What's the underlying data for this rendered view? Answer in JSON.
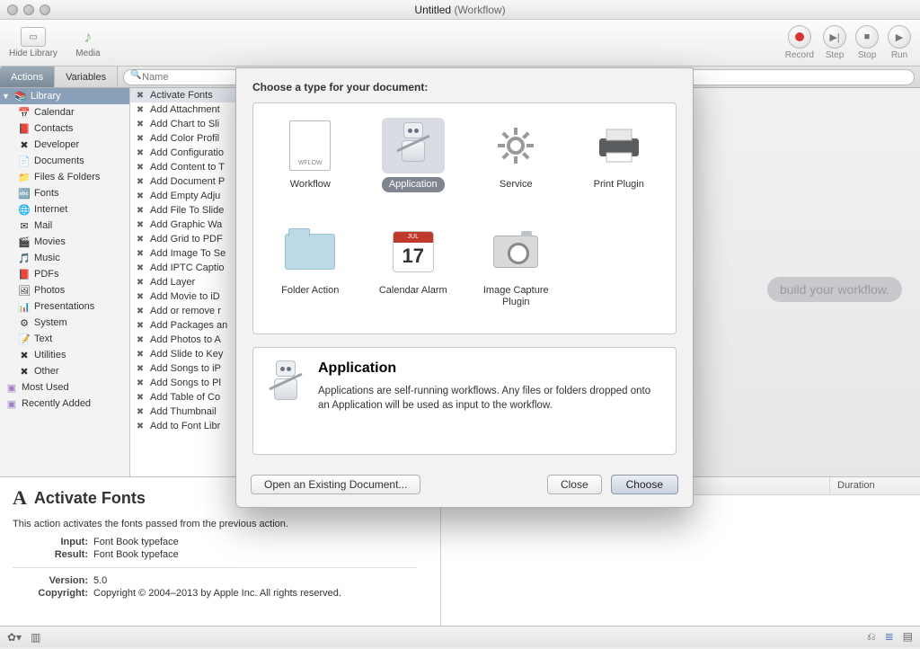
{
  "window": {
    "title_doc": "Untitled",
    "title_app": "(Workflow)"
  },
  "toolbar": {
    "hide_library": "Hide Library",
    "media": "Media",
    "record": "Record",
    "step": "Step",
    "stop": "Stop",
    "run": "Run"
  },
  "tabs": {
    "actions": "Actions",
    "variables": "Variables"
  },
  "search": {
    "placeholder": "Name"
  },
  "sidebar": {
    "library": "Library",
    "items": [
      {
        "icon": "📅",
        "label": "Calendar"
      },
      {
        "icon": "📕",
        "label": "Contacts"
      },
      {
        "icon": "✖",
        "label": "Developer"
      },
      {
        "icon": "📄",
        "label": "Documents"
      },
      {
        "icon": "📁",
        "label": "Files & Folders"
      },
      {
        "icon": "🔤",
        "label": "Fonts"
      },
      {
        "icon": "🌐",
        "label": "Internet"
      },
      {
        "icon": "✉",
        "label": "Mail"
      },
      {
        "icon": "🎬",
        "label": "Movies"
      },
      {
        "icon": "🎵",
        "label": "Music"
      },
      {
        "icon": "📕",
        "label": "PDFs"
      },
      {
        "icon": "🖼",
        "label": "Photos"
      },
      {
        "icon": "📊",
        "label": "Presentations"
      },
      {
        "icon": "⚙",
        "label": "System"
      },
      {
        "icon": "📝",
        "label": "Text"
      },
      {
        "icon": "✖",
        "label": "Utilities"
      },
      {
        "icon": "✖",
        "label": "Other"
      }
    ],
    "most_used": "Most Used",
    "recently_added": "Recently Added"
  },
  "actions": [
    "Activate Fonts",
    "Add Attachment",
    "Add Chart to Sli",
    "Add Color Profil",
    "Add Configuratio",
    "Add Content to T",
    "Add Document P",
    "Add Empty Adju",
    "Add File To Slide",
    "Add Graphic Wa",
    "Add Grid to PDF",
    "Add Image To Se",
    "Add IPTC Captio",
    "Add Layer",
    "Add Movie to iD",
    "Add or remove r",
    "Add Packages an",
    "Add Photos to A",
    "Add Slide to Key",
    "Add Songs to iP",
    "Add Songs to Pl",
    "Add Table of Co",
    "Add Thumbnail",
    "Add to Font Libr"
  ],
  "actions_selected_index": 0,
  "canvas": {
    "hint": "build your workflow."
  },
  "info": {
    "title": "Activate Fonts",
    "desc": "This action activates the fonts passed from the previous action.",
    "input_label": "Input:",
    "input_val": "Font Book typeface",
    "result_label": "Result:",
    "result_val": "Font Book typeface",
    "version_label": "Version:",
    "version_val": "5.0",
    "copyright_label": "Copyright:",
    "copyright_val": "Copyright © 2004–2013 by Apple Inc. All rights reserved."
  },
  "log": {
    "col1": "",
    "col2": "Duration"
  },
  "sheet": {
    "heading": "Choose a type for your document:",
    "types": [
      {
        "key": "workflow",
        "label": "Workflow"
      },
      {
        "key": "application",
        "label": "Application"
      },
      {
        "key": "service",
        "label": "Service"
      },
      {
        "key": "print",
        "label": "Print Plugin"
      },
      {
        "key": "folder",
        "label": "Folder Action"
      },
      {
        "key": "calendar",
        "label": "Calendar Alarm"
      },
      {
        "key": "capture",
        "label": "Image Capture Plugin"
      }
    ],
    "selected_index": 1,
    "desc_title": "Application",
    "desc_body": "Applications are self-running workflows. Any files or folders dropped onto an Application will be used as input to the workflow.",
    "open_existing": "Open an Existing Document...",
    "close": "Close",
    "choose": "Choose",
    "cal_month": "JUL",
    "cal_day": "17"
  }
}
